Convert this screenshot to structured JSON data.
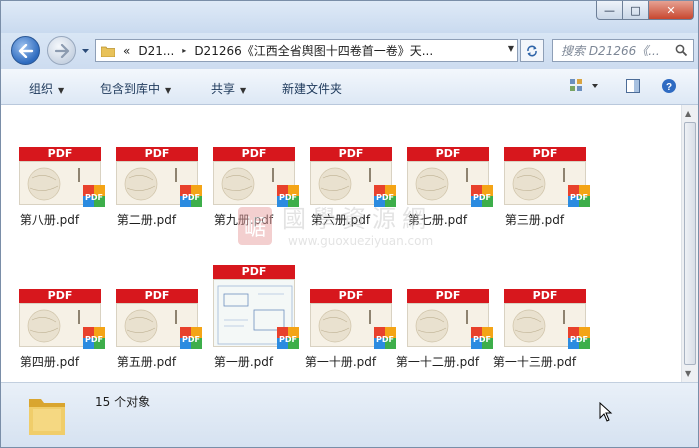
{
  "window": {
    "caption_buttons": {
      "minimize": "—",
      "maximize": "□",
      "close": "✕"
    }
  },
  "navigation": {
    "back_icon": "back-arrow-icon",
    "forward_icon": "forward-arrow-icon",
    "address": {
      "overflow": "«",
      "segment_1": "D21...",
      "separator": "▸",
      "segment_2": "D21266《江西全省舆图十四卷首一卷》天..."
    },
    "search_placeholder": "搜索 D21266《..."
  },
  "toolbar": {
    "organize": "组织",
    "include_in_library": "包含到库中",
    "share": "共享",
    "new_folder": "新建文件夹"
  },
  "files": [
    {
      "name": "第八册.pdf",
      "thumb": "PDF"
    },
    {
      "name": "第二册.pdf",
      "thumb": "PDF"
    },
    {
      "name": "第九册.pdf",
      "thumb": "PDF"
    },
    {
      "name": "第六册.pdf",
      "thumb": "PDF"
    },
    {
      "name": "第七册.pdf",
      "thumb": "PDF"
    },
    {
      "name": "第三册.pdf",
      "thumb": "PDF"
    },
    {
      "name": "第四册.pdf",
      "thumb": "PDF"
    },
    {
      "name": "第五册.pdf",
      "thumb": "PDF"
    },
    {
      "name": "第一册.pdf",
      "thumb": "PDF"
    },
    {
      "name": "第一十册.pdf",
      "thumb": "PDF"
    },
    {
      "name": "第一十二册.pdf",
      "thumb": "PDF"
    },
    {
      "name": "第一十三册.pdf",
      "thumb": "PDF"
    }
  ],
  "watermark": {
    "title": "國學資源網",
    "url": "www.guoxueziyuan.com",
    "seal": "崌"
  },
  "status": {
    "count_text": "15 个对象"
  },
  "colors": {
    "pdf_red": "#d7171d",
    "window_blue": "#cddcf0"
  }
}
